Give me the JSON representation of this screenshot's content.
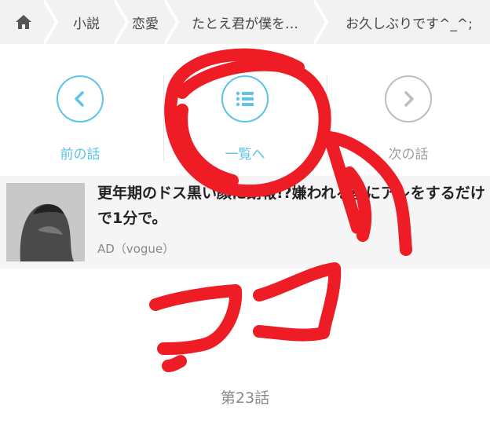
{
  "breadcrumb": {
    "items": [
      "小説",
      "恋愛",
      "たとえ君が僕を…",
      "お久しぶりです^_^;"
    ]
  },
  "nav": {
    "prev_label": "前の話",
    "list_label": "一覧へ",
    "next_label": "次の話"
  },
  "ad": {
    "title": "更年期のドス黒い顔に朗報!?嫌われる前にアレをするだけで1分で。",
    "source": "AD（vogue）"
  },
  "episode": {
    "label": "第23話"
  },
  "annotation": {
    "text": "ココ",
    "color": "#ee1c24"
  },
  "colors": {
    "accent": "#5cc3ea",
    "disabled": "#bdbdbd"
  }
}
